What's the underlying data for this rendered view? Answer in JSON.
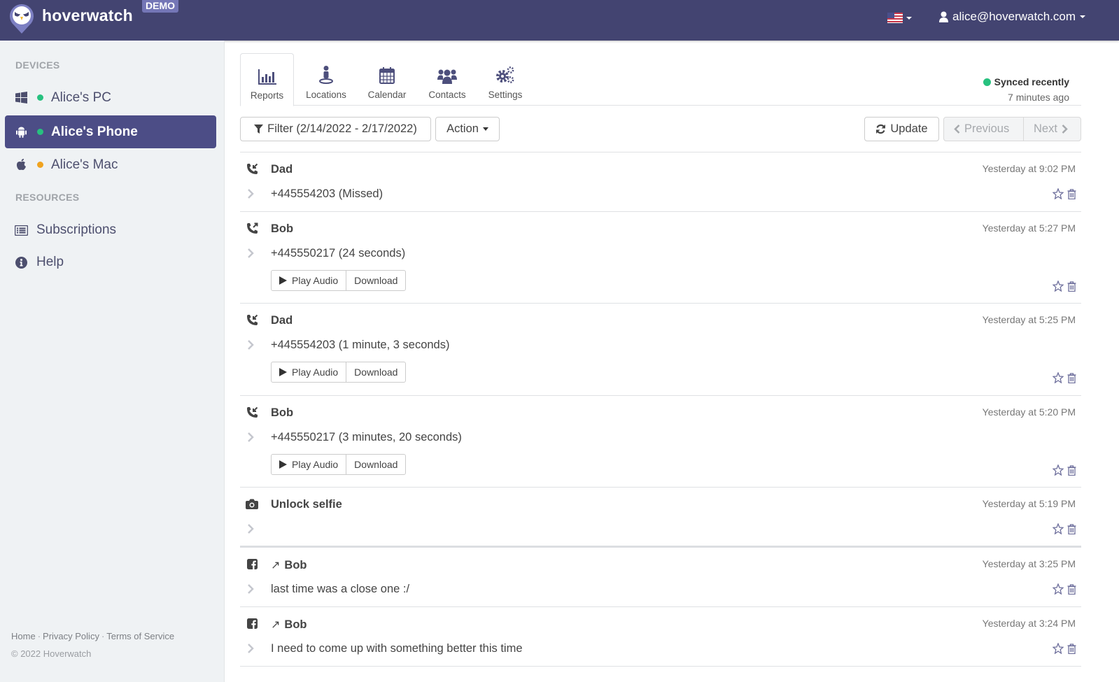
{
  "header": {
    "brand": "hoverwatch",
    "badge": "DEMO",
    "language_flag": "us-flag-icon",
    "user_email": "alice@hoverwatch.com"
  },
  "sidebar": {
    "devices_title": "DEVICES",
    "devices": [
      {
        "label": "Alice's PC",
        "os_icon": "windows-icon",
        "status_color": "#27c17f",
        "active": false
      },
      {
        "label": "Alice's Phone",
        "os_icon": "android-icon",
        "status_color": "#27c17f",
        "active": true
      },
      {
        "label": "Alice's Mac",
        "os_icon": "apple-icon",
        "status_color": "#f0a31f",
        "active": false
      }
    ],
    "resources_title": "RESOURCES",
    "resources": [
      {
        "label": "Subscriptions",
        "icon": "list-alt-icon"
      },
      {
        "label": "Help",
        "icon": "info-circle-icon"
      }
    ],
    "footer": {
      "links": [
        "Home",
        "Privacy Policy",
        "Terms of Service"
      ],
      "copyright": "© 2022 Hoverwatch"
    }
  },
  "tabs": [
    {
      "label": "Reports",
      "icon": "bar-chart-icon",
      "active": true
    },
    {
      "label": "Locations",
      "icon": "street-view-icon",
      "active": false
    },
    {
      "label": "Calendar",
      "icon": "calendar-icon",
      "active": false
    },
    {
      "label": "Contacts",
      "icon": "users-icon",
      "active": false
    },
    {
      "label": "Settings",
      "icon": "gears-icon",
      "active": false
    }
  ],
  "sync": {
    "status": "Synced recently",
    "ago": "7 minutes ago",
    "color": "#27c17f"
  },
  "toolbar": {
    "filter_label": "Filter (2/14/2022 - 2/17/2022)",
    "action_label": "Action",
    "update_label": "Update",
    "previous_label": "Previous",
    "next_label": "Next"
  },
  "entries": [
    {
      "type": "call-missed",
      "icon": "phone-incoming-icon",
      "title": "Dad",
      "time": "Yesterday at 9:02 PM",
      "text": "+445554203 (Missed)",
      "has_audio": false
    },
    {
      "type": "call-outgoing",
      "icon": "phone-outgoing-icon",
      "title": "Bob",
      "time": "Yesterday at 5:27 PM",
      "text": "+445550217 (24 seconds)",
      "has_audio": true
    },
    {
      "type": "call-incoming",
      "icon": "phone-incoming-icon",
      "title": "Dad",
      "time": "Yesterday at 5:25 PM",
      "text": "+445554203 (1 minute, 3 seconds)",
      "has_audio": true
    },
    {
      "type": "call-incoming",
      "icon": "phone-incoming-icon",
      "title": "Bob",
      "time": "Yesterday at 5:20 PM",
      "text": "+445550217 (3 minutes, 20 seconds)",
      "has_audio": true
    },
    {
      "type": "photo",
      "icon": "camera-icon",
      "title": "Unlock selfie",
      "time": "Yesterday at 5:19 PM",
      "text": "",
      "has_audio": false
    },
    {
      "type": "facebook-message",
      "icon": "facebook-icon",
      "direction": "↗",
      "title": "Bob",
      "time": "Yesterday at 3:25 PM",
      "text": "last time was a close one :/",
      "has_audio": false
    },
    {
      "type": "facebook-message",
      "icon": "facebook-icon",
      "direction": "↗",
      "title": "Bob",
      "time": "Yesterday at 3:24 PM",
      "text": "I need to come up with something better this time",
      "has_audio": false
    }
  ],
  "audio_buttons": {
    "play_label": "Play Audio",
    "download_label": "Download"
  }
}
